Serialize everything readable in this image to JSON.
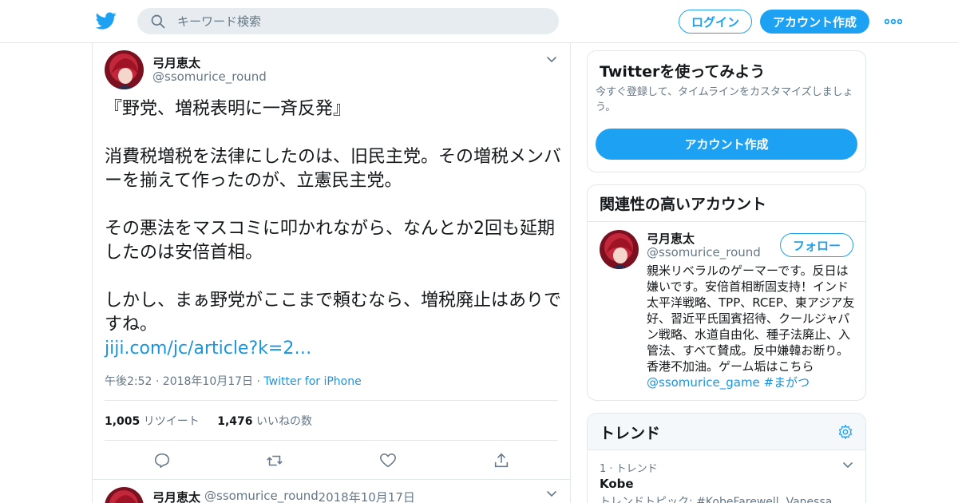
{
  "header": {
    "search_placeholder": "キーワード検索",
    "login_label": "ログイン",
    "signup_label": "アカウント作成"
  },
  "tweet": {
    "author_name": "弓月恵太",
    "author_handle": "@ssomurice_round",
    "text": "『野党、増税表明に一斉反発』\n\n消費税増税を法律にしたのは、旧民主党。その増税メンバーを揃えて作ったのが、立憲民主党。\n\nその悪法をマスコミに叩かれながら、なんとか2回も延期したのは安倍首相。\n\nしかし、まぁ野党がここまで頼むなら、増税廃止はありですね。",
    "link": "jiji.com/jc/article?k=2…",
    "timestamp": "午後2:52 · 2018年10月17日",
    "separator": " · ",
    "source": "Twitter for iPhone",
    "retweet_count": "1,005",
    "retweet_label": "リツイート",
    "like_count": "1,476",
    "like_label": "いいねの数"
  },
  "reply": {
    "author_name": "弓月恵太",
    "author_handle": "@ssomurice_round",
    "date": "· 2018年10月17日"
  },
  "signup_card": {
    "title": "Twitterを使ってみよう",
    "subtitle": "今すぐ登録して、タイムラインをカスタマイズしましょう。",
    "button_label": "アカウント作成"
  },
  "related_card": {
    "title": "関連性の高いアカウント",
    "name": "弓月恵太",
    "handle": "@ssomurice_round",
    "follow_label": "フォロー",
    "bio": "親米リベラルのゲーマーです。反日は嫌いです。安倍首相断固支持！インド太平洋戦略、TPP、RCEP、東アジア友好、習近平氏国賓招待、クールジャパン戦略、水道自由化、種子法廃止、入管法、すべて賛成。反中嫌韓お断り。香港不加油。ゲーム垢はこちら",
    "bio_link1": "@ssomurice_game",
    "bio_link2": "#まがつ"
  },
  "trends_card": {
    "title": "トレンド",
    "trend_meta": "1 · トレンド",
    "trend_name": "Kobe",
    "trend_topic": "トレンドトピック: #KobeFarewell, Vanessa"
  },
  "colors": {
    "accent": "#1da1f2",
    "link": "#1b95e0",
    "text": "#14171a",
    "muted": "#657786",
    "border": "#e1e8ed"
  },
  "icons": [
    "twitter-bird-icon",
    "search-icon",
    "more-dots-icon",
    "chevron-down-icon",
    "reply-icon",
    "retweet-icon",
    "like-icon",
    "share-icon",
    "gear-icon"
  ]
}
